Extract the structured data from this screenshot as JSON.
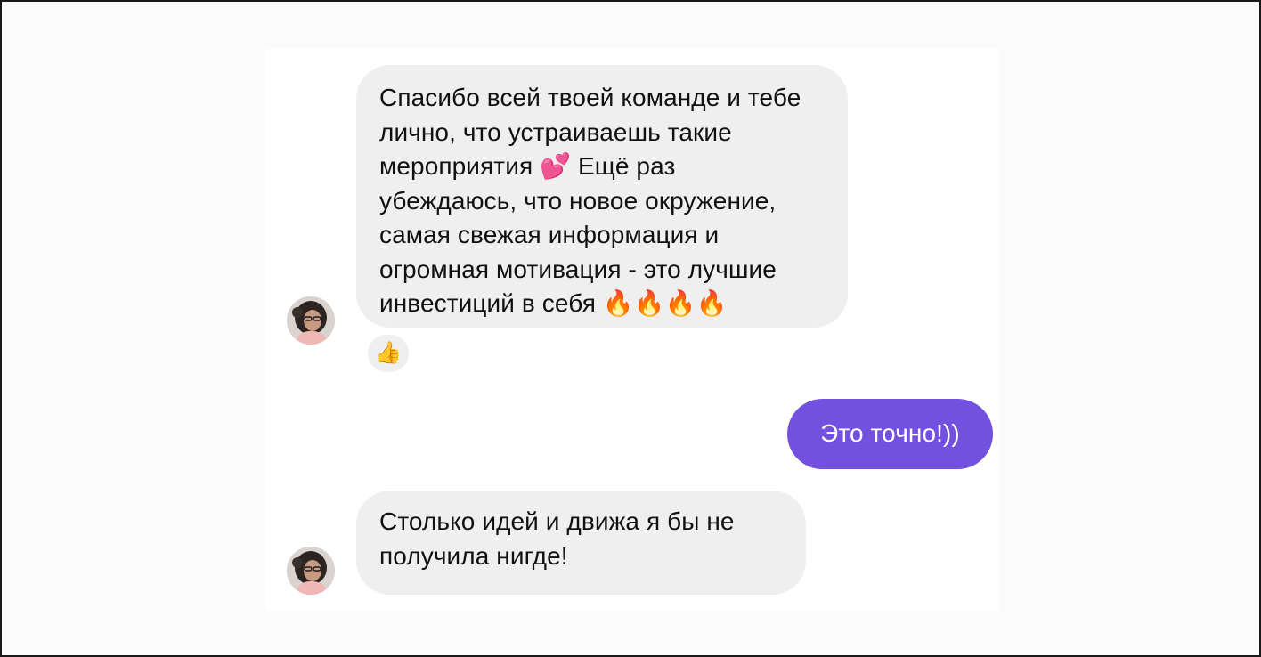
{
  "conversation": {
    "messages": [
      {
        "direction": "incoming",
        "text": "Спасибо всей твоей команде и тебе\nлично,  что устраиваешь такие\nмероприятия 💕 Ещё раз\nубеждаюсь,  что новое окружение,\nсамая свежая информация  и\nогромная мотивация - это лучшие\nинвестиций в себя 🔥🔥🔥🔥",
        "reaction": "👍"
      },
      {
        "direction": "outgoing",
        "text": "Это точно!))"
      },
      {
        "direction": "incoming",
        "text": "Столько идей и движа я бы не\nполучила нигде!"
      }
    ]
  },
  "colors": {
    "incoming_bubble": "#efefef",
    "outgoing_bubble": "#7350de",
    "text": "#111111",
    "outgoing_text": "#ffffff"
  },
  "icons": {
    "avatar": "user-avatar-photo",
    "reaction": "thumbs-up-emoji"
  }
}
